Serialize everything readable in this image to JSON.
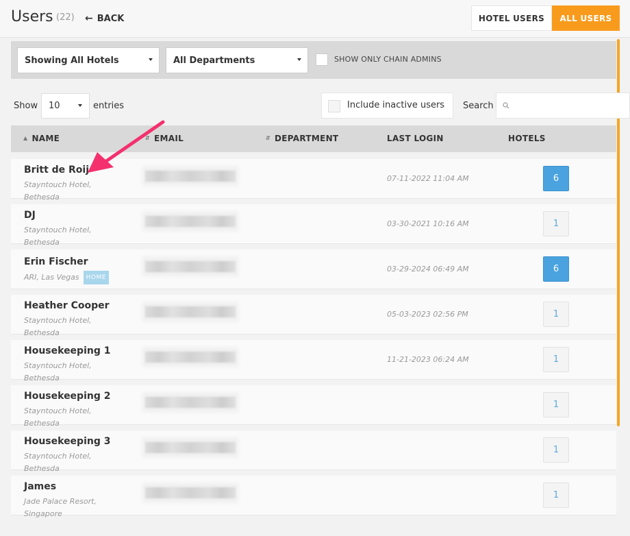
{
  "header": {
    "title": "Users",
    "count": "(22)",
    "back_label": "BACK",
    "tabs": [
      {
        "label": "HOTEL USERS",
        "active": false
      },
      {
        "label": "ALL USERS",
        "active": true
      }
    ]
  },
  "filters": {
    "hotels": "Showing All Hotels",
    "departments": "All Departments",
    "chain_admins_label": "SHOW ONLY CHAIN ADMINS"
  },
  "controls": {
    "show_label": "Show",
    "entries_value": "10",
    "entries_label": "entries",
    "inactive_label": "Include inactive users",
    "search_label": "Search",
    "search_value": ""
  },
  "columns": {
    "name": "NAME",
    "email": "EMAIL",
    "department": "DEPARTMENT",
    "last_login": "LAST LOGIN",
    "hotels": "HOTELS"
  },
  "rows": [
    {
      "name": "Britt de Roij",
      "loc1": "Stayntouch Hotel,",
      "loc2": "Bethesda",
      "login": "07-11-2022 11:04 AM",
      "hotels": "6"
    },
    {
      "name": "DJ",
      "loc1": "Stayntouch Hotel,",
      "loc2": "Bethesda",
      "login": "03-30-2021 10:16 AM",
      "hotels": "1"
    },
    {
      "name": "Erin Fischer",
      "loc1": "ARI, Las Vegas",
      "loc2": "",
      "badge": "HOME",
      "login": "03-29-2024 06:49 AM",
      "hotels": "6"
    },
    {
      "name": "Heather Cooper",
      "loc1": "Stayntouch Hotel,",
      "loc2": "Bethesda",
      "login": "05-03-2023 02:56 PM",
      "hotels": "1"
    },
    {
      "name": "Housekeeping 1",
      "loc1": "Stayntouch Hotel,",
      "loc2": "Bethesda",
      "login": "11-21-2023 06:24 AM",
      "hotels": "1"
    },
    {
      "name": "Housekeeping 2",
      "loc1": "Stayntouch Hotel,",
      "loc2": "Bethesda",
      "login": "",
      "hotels": "1"
    },
    {
      "name": "Housekeeping 3",
      "loc1": "Stayntouch Hotel,",
      "loc2": "Bethesda",
      "login": "",
      "hotels": "1"
    },
    {
      "name": "James",
      "loc1": "Jade Palace Resort,",
      "loc2": "Singapore",
      "login": "",
      "hotels": "1"
    }
  ],
  "colors": {
    "accent": "#f89b1c",
    "hotel_badge_blue": "#4aa3df",
    "annotation_arrow": "#f4306e"
  }
}
